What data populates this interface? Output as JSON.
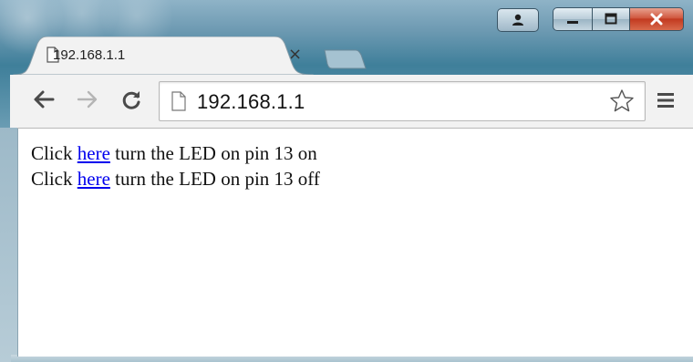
{
  "browser": {
    "tab": {
      "title": "192.168.1.1",
      "close_glyph": "×"
    },
    "toolbar": {
      "back_icon": "back-arrow-icon",
      "forward_icon": "forward-arrow-icon",
      "reload_icon": "reload-icon",
      "url": "192.168.1.1",
      "bookmark_icon": "star-icon",
      "menu_icon": "hamburger-menu-icon"
    },
    "window_controls": [
      "user-icon",
      "minimize-icon",
      "maximize-icon",
      "close-icon"
    ]
  },
  "page": {
    "lines": [
      {
        "prefix": "Click ",
        "link": "here",
        "suffix": " turn the LED on pin 13 on"
      },
      {
        "prefix": "Click ",
        "link": "here",
        "suffix": " turn the LED on pin 13 off"
      }
    ],
    "link_color": "#0000ee"
  },
  "colors": {
    "titlebar": "#3f7f9a",
    "close_button": "#c23a20",
    "toolbar": "#f2f2f2"
  }
}
